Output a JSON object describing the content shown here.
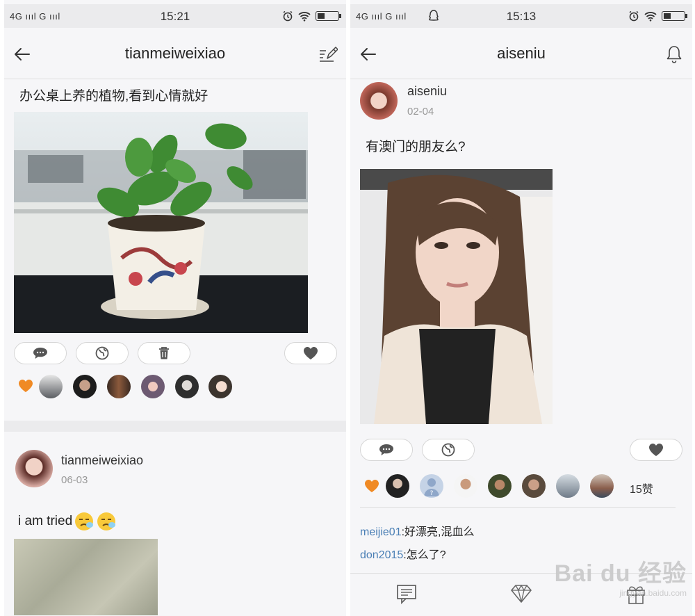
{
  "left": {
    "status": {
      "signal": "4G ıııl  G ıııl",
      "time": "15:21"
    },
    "nav": {
      "title": "tianmeiweixiao"
    },
    "post1": {
      "text": "办公桌上养的植物,看到心情就好"
    },
    "post2": {
      "username": "tianmeiweixiao",
      "date": "06-03",
      "text": "i am tried"
    }
  },
  "right": {
    "status": {
      "signal": "4G ıııl  G ıııl",
      "time": "15:13"
    },
    "nav": {
      "title": "aiseniu"
    },
    "post": {
      "username": "aiseniu",
      "date": "02-04",
      "text": "有澳门的朋友么?",
      "like_count": "15赞"
    },
    "comments": [
      {
        "user": "meijie01",
        "text": ":好漂亮,混血么"
      },
      {
        "user": "don2015",
        "text": ":怎么了?"
      }
    ]
  },
  "watermark": {
    "logo": "Bai du 经验",
    "url": "jingyan.baidu.com"
  },
  "colors": {
    "like": "#f08a24",
    "link": "#4a7fb5",
    "statusbar": "#ebebed",
    "page": "#f6f6f8"
  },
  "icons": [
    "back-arrow-icon",
    "edit-icon",
    "bell-icon",
    "comment-icon",
    "globe-icon",
    "trash-icon",
    "heart-icon",
    "chat-tab-icon",
    "diamond-tab-icon",
    "gift-tab-icon",
    "alarm-icon",
    "wifi-icon",
    "battery-icon",
    "qq-icon"
  ]
}
